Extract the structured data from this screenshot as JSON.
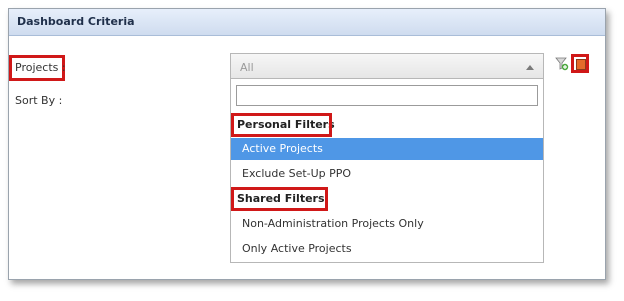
{
  "panel": {
    "title": "Dashboard Criteria",
    "projects_label": "Projects :",
    "sort_by_label": "Sort By :"
  },
  "combo": {
    "selected_value": "All",
    "search_value": ""
  },
  "dropdown": {
    "groups": [
      {
        "label": "Personal Filters",
        "items": [
          {
            "label": "Active Projects",
            "selected": true
          },
          {
            "label": "Exclude Set-Up PPO",
            "selected": false
          }
        ]
      },
      {
        "label": "Shared Filters",
        "items": [
          {
            "label": "Non-Administration Projects Only",
            "selected": false
          },
          {
            "label": "Only Active Projects",
            "selected": false
          }
        ]
      }
    ]
  },
  "icons": {
    "filter": "add-filter-icon",
    "edit": "edit-filter-icon"
  },
  "colors": {
    "highlight": "#d01818",
    "selected_row": "#4f97e6",
    "header_bg": "#cfdcef"
  }
}
